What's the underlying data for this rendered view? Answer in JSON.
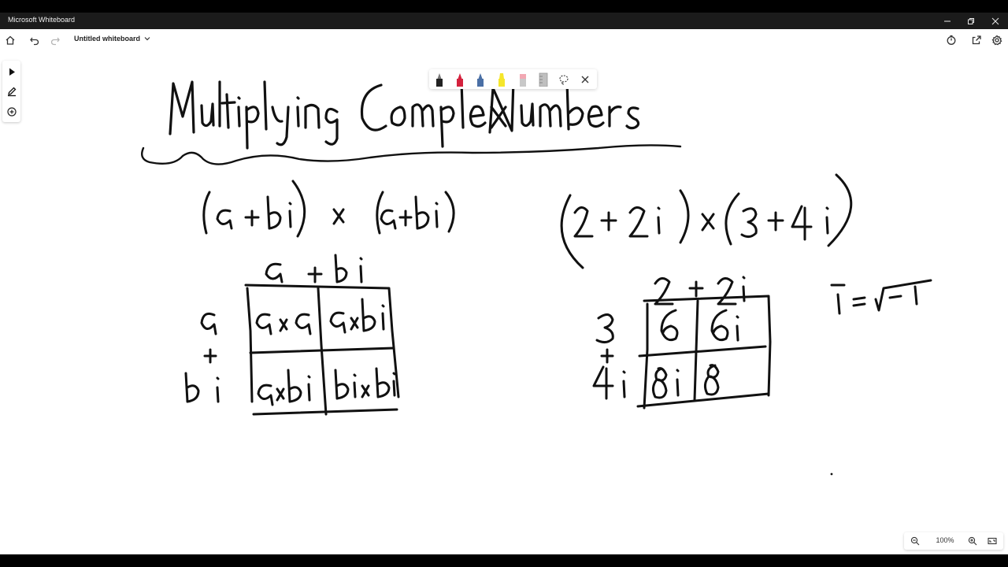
{
  "window": {
    "app_title": "Microsoft Whiteboard"
  },
  "toolbar": {
    "document_title": "Untitled whiteboard",
    "icons": [
      "home-icon",
      "undo-icon",
      "redo-icon",
      "chevron-down-icon",
      "timer-icon",
      "share-icon",
      "settings-icon"
    ]
  },
  "left_tools": {
    "icons": [
      "select-arrow-icon",
      "pen-icon",
      "add-icon"
    ]
  },
  "pen_tray": {
    "pens": [
      {
        "name": "black-pen",
        "color": "#222222"
      },
      {
        "name": "red-pen",
        "color": "#d4213d"
      },
      {
        "name": "blue-pen",
        "color": "#4a6fa5"
      },
      {
        "name": "highlighter",
        "color": "#f5e62b"
      },
      {
        "name": "eraser",
        "color": "#f2a8b3"
      },
      {
        "name": "ruler",
        "color": "#bfbfbf"
      }
    ],
    "icons": [
      "lasso-icon",
      "close-icon"
    ]
  },
  "zoom": {
    "level": "100%"
  },
  "whiteboard_ink": {
    "heading": "Multiplying Complex Numbers",
    "left_expression": "(a+bi) x (a+bi)",
    "right_expression": "(2+2i) x (3+4i)",
    "left_grid": {
      "column_header": "a + bi",
      "row_headers": [
        "a",
        "+",
        "bi"
      ],
      "cells": [
        "a×a",
        "a×bi",
        "a×bi",
        "bi×bi"
      ]
    },
    "right_grid": {
      "column_header": "2 + 2i",
      "row_headers": [
        "3",
        "+",
        "4i"
      ],
      "cells": [
        "6",
        "6i",
        "8i",
        "8"
      ]
    },
    "identity": "i = √-1"
  }
}
